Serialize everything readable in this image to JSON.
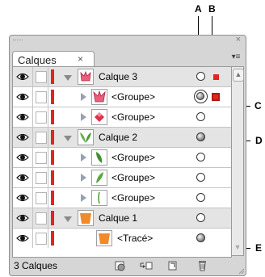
{
  "callouts": [
    "A",
    "B",
    "C",
    "D",
    "E"
  ],
  "panel": {
    "tab_label": "Calques",
    "close_glyph": "×",
    "titlebar_close": "×",
    "menu_glyph": "▾≡",
    "footer_count": "3 Calques"
  },
  "rows": [
    {
      "kind": "layer",
      "name": "Calque 3",
      "thumb": "red-flower",
      "target": "empty",
      "selected": "small"
    },
    {
      "kind": "child",
      "name": "<Groupe>",
      "thumb": "red-flower",
      "target": "double",
      "selected": "big"
    },
    {
      "kind": "child",
      "name": "<Groupe>",
      "thumb": "red-diamond",
      "target": "empty",
      "selected": "none"
    },
    {
      "kind": "layer",
      "name": "Calque 2",
      "thumb": "green-leaves",
      "target": "filled",
      "selected": "none"
    },
    {
      "kind": "child",
      "name": "<Groupe>",
      "thumb": "green-leaf-1",
      "target": "empty",
      "selected": "none"
    },
    {
      "kind": "child",
      "name": "<Groupe>",
      "thumb": "green-leaf-2",
      "target": "empty",
      "selected": "none"
    },
    {
      "kind": "child",
      "name": "<Groupe>",
      "thumb": "green-stem",
      "target": "empty",
      "selected": "none"
    },
    {
      "kind": "layer",
      "name": "Calque 1",
      "thumb": "orange-pot",
      "target": "empty",
      "selected": "none"
    },
    {
      "kind": "path",
      "name": "<Tracé>",
      "thumb": "orange-pot",
      "target": "filled",
      "selected": "none"
    }
  ],
  "colors": {
    "layer_color": "#e1261c",
    "panel_bg": "#d6d6d6",
    "layer_row_bg": "#e4e4e4"
  },
  "footer_buttons": [
    "make-clipping-mask-icon",
    "create-sublayer-icon",
    "create-new-layer-icon",
    "delete-layer-icon"
  ]
}
